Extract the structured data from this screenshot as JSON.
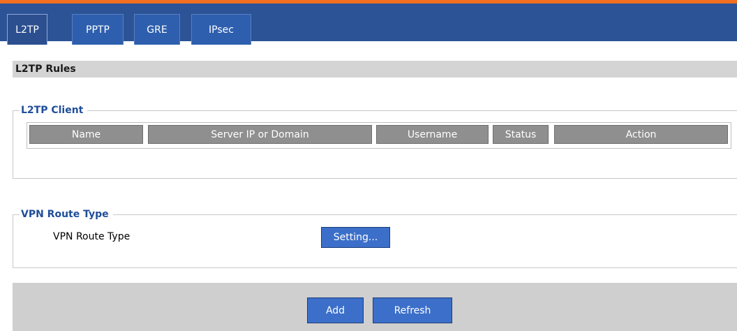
{
  "tabs": [
    {
      "label": "L2TP",
      "active": true
    },
    {
      "label": "PPTP",
      "active": false
    },
    {
      "label": "GRE",
      "active": false
    },
    {
      "label": "IPsec",
      "active": false
    }
  ],
  "section_title": "L2TP Rules",
  "client": {
    "legend": "L2TP Client",
    "columns": [
      "Name",
      "Server IP or Domain",
      "Username",
      "Status",
      "Action"
    ]
  },
  "route": {
    "legend": "VPN Route Type",
    "label": "VPN Route Type",
    "setting_button": "Setting..."
  },
  "footer": {
    "add_button": "Add",
    "refresh_button": "Refresh"
  },
  "colors": {
    "accent_bar": "#f26f21",
    "tabbar": "#2b5396",
    "legend_text": "#1f4e9a",
    "button": "#3c6fc9"
  }
}
